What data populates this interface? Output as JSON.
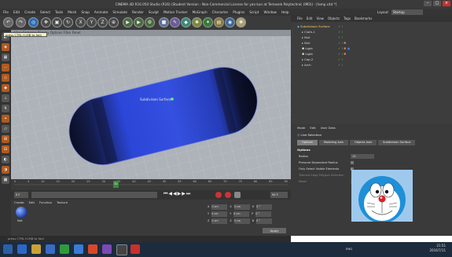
{
  "window": {
    "title": "CINEMA 4D R16.050 Studio (R16) (Student Version - Non-Commercial License for yan kun at Temasek Polytechnic (IM3)) - [lamp.c4d *]",
    "layout_label": "Layout:",
    "layout_value": "Startup"
  },
  "menu": [
    "File",
    "Edit",
    "Create",
    "Select",
    "Tools",
    "Mesh",
    "Snap",
    "Animate",
    "Simulate",
    "Render",
    "Sculpt",
    "Motion Tracker",
    "MoGraph",
    "Character",
    "Plugins",
    "Script",
    "Window",
    "Help"
  ],
  "viewport": {
    "tooltip": "press CTRL+LMB to fold",
    "menu": "View  Cameras  Display  Options  Filter  Panel",
    "object_label": "Subdivision Surface"
  },
  "timeline": {
    "ticks": [
      "0",
      "5",
      "10",
      "15",
      "20",
      "25",
      "30",
      "35",
      "40",
      "45",
      "50",
      "55",
      "60",
      "65",
      "70",
      "75",
      "80",
      "85",
      "90"
    ],
    "frame_left": "0 F",
    "frame_right": "90 F",
    "current": "32"
  },
  "material": {
    "menu": [
      "Create",
      "Edit",
      "Function",
      "Texture"
    ],
    "mat_label": "Mat"
  },
  "coords": {
    "rows": [
      {
        "a": "X",
        "av": "0 cm",
        "b": "X",
        "bv": "0 cm",
        "c": "H",
        "cv": "0 °"
      },
      {
        "a": "Y",
        "av": "0 cm",
        "b": "Y",
        "bv": "0 cm",
        "c": "P",
        "cv": "0 °"
      },
      {
        "a": "Z",
        "av": "0 cm",
        "b": "Z",
        "bv": "0 cm",
        "c": "B",
        "cv": "0 °"
      }
    ],
    "apply": "Apply"
  },
  "status": "press CTRL+LMB to fold",
  "objects": {
    "menu": [
      "File",
      "Edit",
      "View",
      "Objects",
      "Tags",
      "Bookmarks"
    ],
    "items": [
      "Subdivision Surface",
      "Cloth-1",
      "Null",
      "Null",
      "Light",
      "Light",
      "Cap-2",
      "Arch"
    ]
  },
  "attributes": {
    "menu": [
      "Mode",
      "Edit",
      "User Data"
    ],
    "title": "Live Selection",
    "tabs": [
      "Options",
      "Modeling Axis",
      "Objects Axis",
      "Subdivision Surface"
    ],
    "section": "Options",
    "rows": [
      {
        "label": "Radius",
        "value": "10"
      },
      {
        "label": "Pressure Dependent Radius",
        "value": ""
      },
      {
        "label": "Only Select Visible Elements",
        "value": ""
      },
      {
        "label": "Tolerant Edge Polygon Selection",
        "value": ""
      },
      {
        "label": "Mode",
        "value": "Normal"
      }
    ]
  },
  "clock": {
    "time": "21:51",
    "date": "2016/7/11",
    "lang": "ENG"
  },
  "colors": {
    "accent": "#2b46d8",
    "panel": "#3a3a3a",
    "viewport": "#aeb3ba"
  }
}
